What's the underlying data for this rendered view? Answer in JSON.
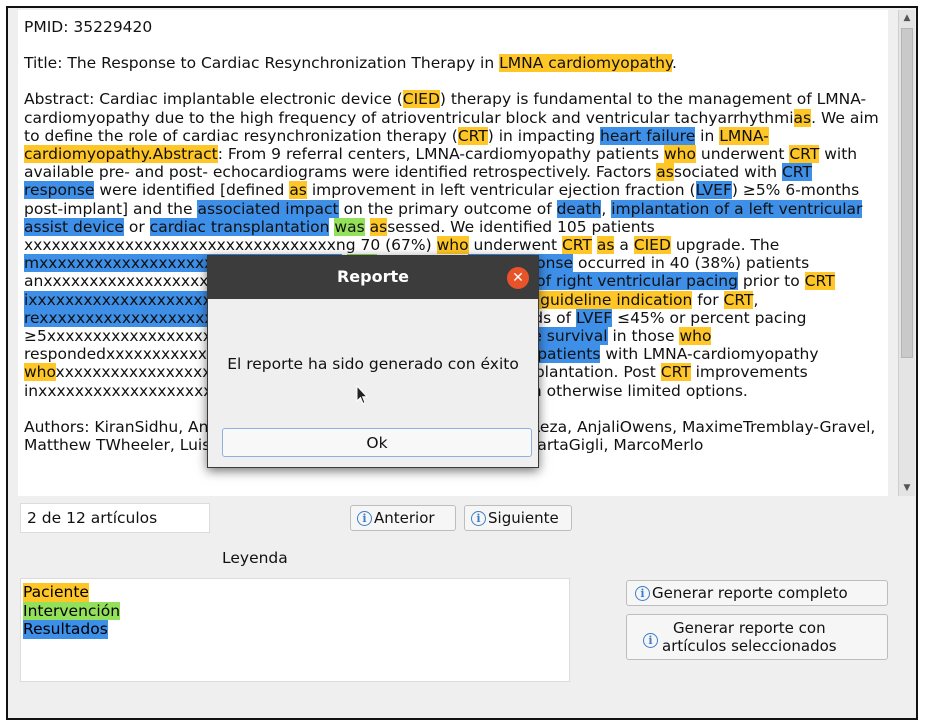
{
  "document": {
    "pmid": "PMID: 35229420",
    "title": [
      {
        "t": "Title: The Response to Cardiac Resynchronization Therapy in "
      },
      {
        "t": "LMNA cardiomyopathy",
        "h": "o"
      },
      {
        "t": "."
      }
    ],
    "abstract": [
      {
        "t": "Abstract: Cardiac implantable electronic device ("
      },
      {
        "t": "CIED",
        "h": "o"
      },
      {
        "t": ") therapy is fundamental to the management of LMNA-cardiomyopathy due to the high frequency of atrioventricular block and ventricular tachyarrhythmi"
      },
      {
        "t": "as",
        "h": "o"
      },
      {
        "t": ". We aim to define the role of cardiac resynchronization therapy ("
      },
      {
        "t": "CRT",
        "h": "o"
      },
      {
        "t": ") in impacting "
      },
      {
        "t": "heart failure",
        "h": "b"
      },
      {
        "t": " in "
      },
      {
        "t": "LMNA-cardiomyopathy.Abstract",
        "h": "o"
      },
      {
        "t": ": From 9 referral centers, LMNA-cardiomyopathy patients "
      },
      {
        "t": "who",
        "h": "o"
      },
      {
        "t": " underwent "
      },
      {
        "t": "CRT",
        "h": "o"
      },
      {
        "t": " with available pre- and post- echocardiograms were identified retrospectively. Factors "
      },
      {
        "t": "as",
        "h": "o"
      },
      {
        "t": "sociated with "
      },
      {
        "t": "CRT response",
        "h": "b"
      },
      {
        "t": " were identified [defined "
      },
      {
        "t": "as",
        "h": "o"
      },
      {
        "t": " improvement in left ventricular ejection fraction ("
      },
      {
        "t": "LVEF",
        "h": "b"
      },
      {
        "t": ") ≥5% 6-months post-implant] and the "
      },
      {
        "t": "associated impact",
        "h": "b"
      },
      {
        "t": " on the primary outcome of "
      },
      {
        "t": "death",
        "h": "b"
      },
      {
        "t": ", "
      },
      {
        "t": "implantation of a left ventricular assist device",
        "h": "b"
      },
      {
        "t": " or "
      },
      {
        "t": "cardiac transplantation",
        "h": "b"
      },
      {
        "t": " "
      },
      {
        "t": "was",
        "h": "g"
      },
      {
        "t": " "
      },
      {
        "t": "as",
        "h": "o"
      },
      {
        "t": "sessed. We identified 105 patients"
      },
      {
        "t": " "
      },
      {
        "t": "xxxxxxxxxxxxxxxxxxxxxxxxxxxxxxxxxx"
      },
      {
        "t": "ng 70 (67%) "
      },
      {
        "t": "who",
        "h": "o"
      },
      {
        "t": " underwent "
      },
      {
        "t": "CRT",
        "h": "o"
      },
      {
        "t": " "
      },
      {
        "t": "as",
        "h": "o"
      },
      {
        "t": " a "
      },
      {
        "t": "CIED",
        "h": "o"
      },
      {
        "t": " upgrade. The "
      },
      {
        "t": "mxxxxxxxxxxxxxxxxxxxxxxxxxxxxxxxxx",
        "h": "b"
      },
      {
        "t": " "
      },
      {
        "t": "was",
        "h": "g"
      },
      {
        "t": " +4±9%. A "
      },
      {
        "t": "CRT response",
        "h": "b"
      },
      {
        "t": " occurred in 40 (38%) patients an"
      },
      {
        "t": "xxxxxxxxxxxxxxxxxxxxxxxxxxxxxxxxxx"
      },
      {
        "t": "F",
        "h": "b"
      },
      {
        "t": " or a high "
      },
      {
        "t": "percentage of right ventricular pacing",
        "h": "b"
      },
      {
        "t": " prior to "
      },
      {
        "t": "CRT",
        "h": "o"
      },
      {
        "t": " "
      },
      {
        "t": "ixxxxxxxxxxxxxxxxxxxxxxxxxxxxxxxxxxxxnts",
        "h": "b"
      },
      {
        "t": " with an "
      },
      {
        "t": "ESC Class I guideline indication",
        "h": "o"
      },
      {
        "t": " for "
      },
      {
        "t": "CRT",
        "h": "o"
      },
      {
        "t": ", "
      },
      {
        "t": "rexxxxxxxxxxxxxxxxxxxxxxxxxxxxxxxxxx",
        "h": "b"
      },
      {
        "t": "was",
        "h": "g"
      },
      {
        "t": " evident at thresholds of "
      },
      {
        "t": "LVEF",
        "h": "b"
      },
      {
        "t": " ≤45% or percent pacing ≥5"
      },
      {
        "t": "xxxxxxxxxxxxxxxxxxxxxxxxxxxxxxx"
      },
      {
        "t": "ian difference",
        "h": "b"
      },
      {
        "t": " in "
      },
      {
        "t": "event-free survival",
        "h": "b"
      },
      {
        "t": " in those "
      },
      {
        "t": "who",
        "h": "o"
      },
      {
        "t": " responded"
      },
      {
        "t": "xxxxxxxxxxxxxxxxxxxxxxxxxxxxxxxxxx"
      },
      {
        "t": "on improves "
      },
      {
        "t": "in patients",
        "h": "b"
      },
      {
        "t": " with LMNA-cardiomyopathy "
      },
      {
        "t": "who",
        "h": "o"
      },
      {
        "t": "xxxxxxxxxxxxxxxxxxxxxxxxxxxxxxxxx"
      },
      {
        "t": "eline indications for implantation. Post "
      },
      {
        "t": "CRT",
        "h": "o"
      },
      {
        "t": " improvements in"
      },
      {
        "t": "xxxxxxxxxxxxxxxxxxxxxxxxxxxxxxxxxx"
      },
      {
        "t": "ts",
        "h": "b"
      },
      {
        "t": " in this population with otherwise limited options."
      }
    ],
    "authors": [
      {
        "t": "Authors: KiranSidhu, Anna IsottaCa"
      },
      {
        "t": "st",
        "h": "o"
      },
      {
        "t": "rini, VictoriaParikh, NosheenReza, AnjaliOwens, MaximeTremblay-Gravel, Matthew TWheeler, LuisaMestroni, MatthewTaylor, SharonGraw, MartaGigli, MarcoMerlo"
      }
    ]
  },
  "navigation": {
    "count": "2 de 12 artículos",
    "prev_label": "Anterior",
    "next_label": "Siguiente"
  },
  "legend": {
    "title": "Leyenda",
    "items": [
      {
        "label": "Paciente",
        "color": "#ffc627"
      },
      {
        "label": "Intervención",
        "color": "#93e05a"
      },
      {
        "label": "Resultados",
        "color": "#3d8fe8"
      }
    ]
  },
  "actions": {
    "full_report": "Generar reporte completo",
    "selected_report_line1": "Generar reporte con",
    "selected_report_line2": "artículos seleccionados"
  },
  "dialog": {
    "title": "Reporte",
    "message": "El reporte ha sido generado con éxito",
    "ok_label": "Ok"
  },
  "colors": {
    "patient": "#ffc627",
    "intervention": "#93e05a",
    "outcome": "#3d8fe8",
    "dialog_header": "#3c3c3c",
    "close_button": "#e8532a"
  }
}
